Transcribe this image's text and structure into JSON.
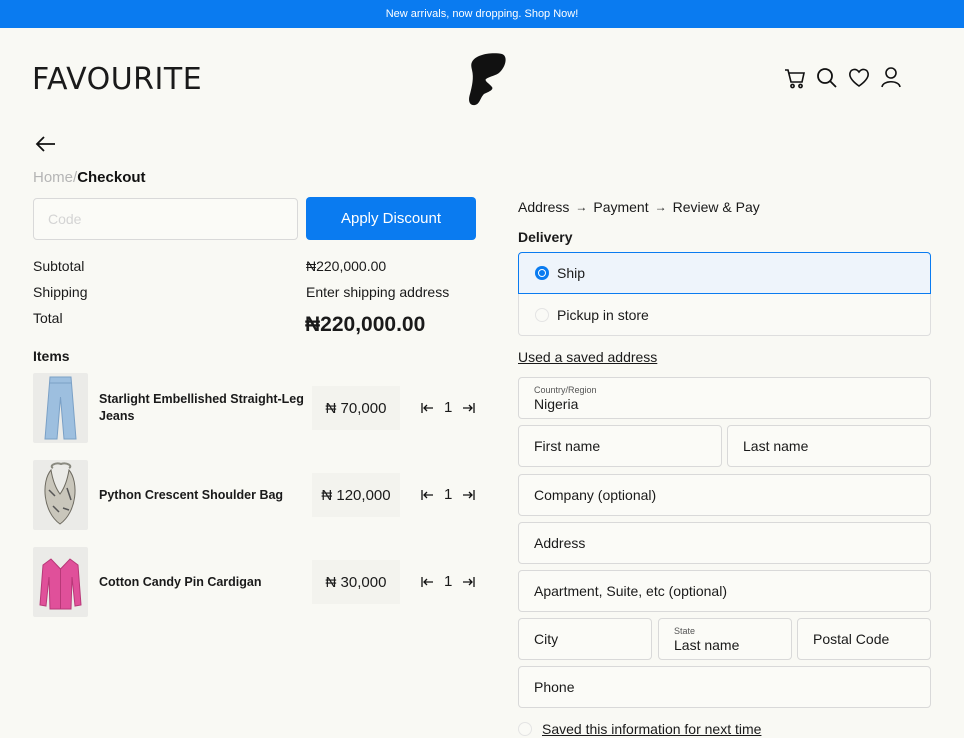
{
  "announcement": "New arrivals, now dropping. Shop Now!",
  "brand": "FAVOURITE",
  "header_icons": [
    "cart-icon",
    "search-icon",
    "heart-icon",
    "user-icon"
  ],
  "breadcrumb": {
    "home": "Home",
    "separator": "/",
    "current": "Checkout"
  },
  "discount": {
    "placeholder": "Code",
    "button_label": "Apply Discount"
  },
  "summary": {
    "subtotal_label": "Subtotal",
    "subtotal_value": "₦220,000.00",
    "shipping_label": "Shipping",
    "shipping_value": "Enter shipping address",
    "total_label": "Total",
    "total_value": "₦220,000.00"
  },
  "items_title": "Items",
  "items": [
    {
      "name": "Starlight Embellished  Straight-Leg Jeans",
      "price": "₦ 70,000",
      "qty": "1"
    },
    {
      "name": "Python Crescent Shoulder Bag",
      "price": "₦ 120,000",
      "qty": "1"
    },
    {
      "name": "Cotton Candy  Pin Cardigan",
      "price": "₦ 30,000",
      "qty": "1"
    }
  ],
  "steps": [
    "Address",
    "Payment",
    "Review & Pay"
  ],
  "step_arrow": "→",
  "delivery": {
    "title": "Delivery",
    "options": [
      {
        "label": "Ship",
        "selected": true
      },
      {
        "label": "Pickup in store",
        "selected": false
      }
    ]
  },
  "saved_address_link": "Used a saved address",
  "form": {
    "country_label": "Country/Region",
    "country_value": "Nigeria",
    "first_name": "First name",
    "last_name": "Last name",
    "company": "Company (optional)",
    "address": "Address",
    "apartment": "Apartment, Suite, etc (optional)",
    "city": "City",
    "state_label": "State",
    "state_value": "Last name",
    "postal": "Postal Code",
    "phone": "Phone"
  },
  "save_info": "Saved this information for next time",
  "colors": {
    "accent": "#0a7bf0",
    "background": "#f9f9f4"
  }
}
